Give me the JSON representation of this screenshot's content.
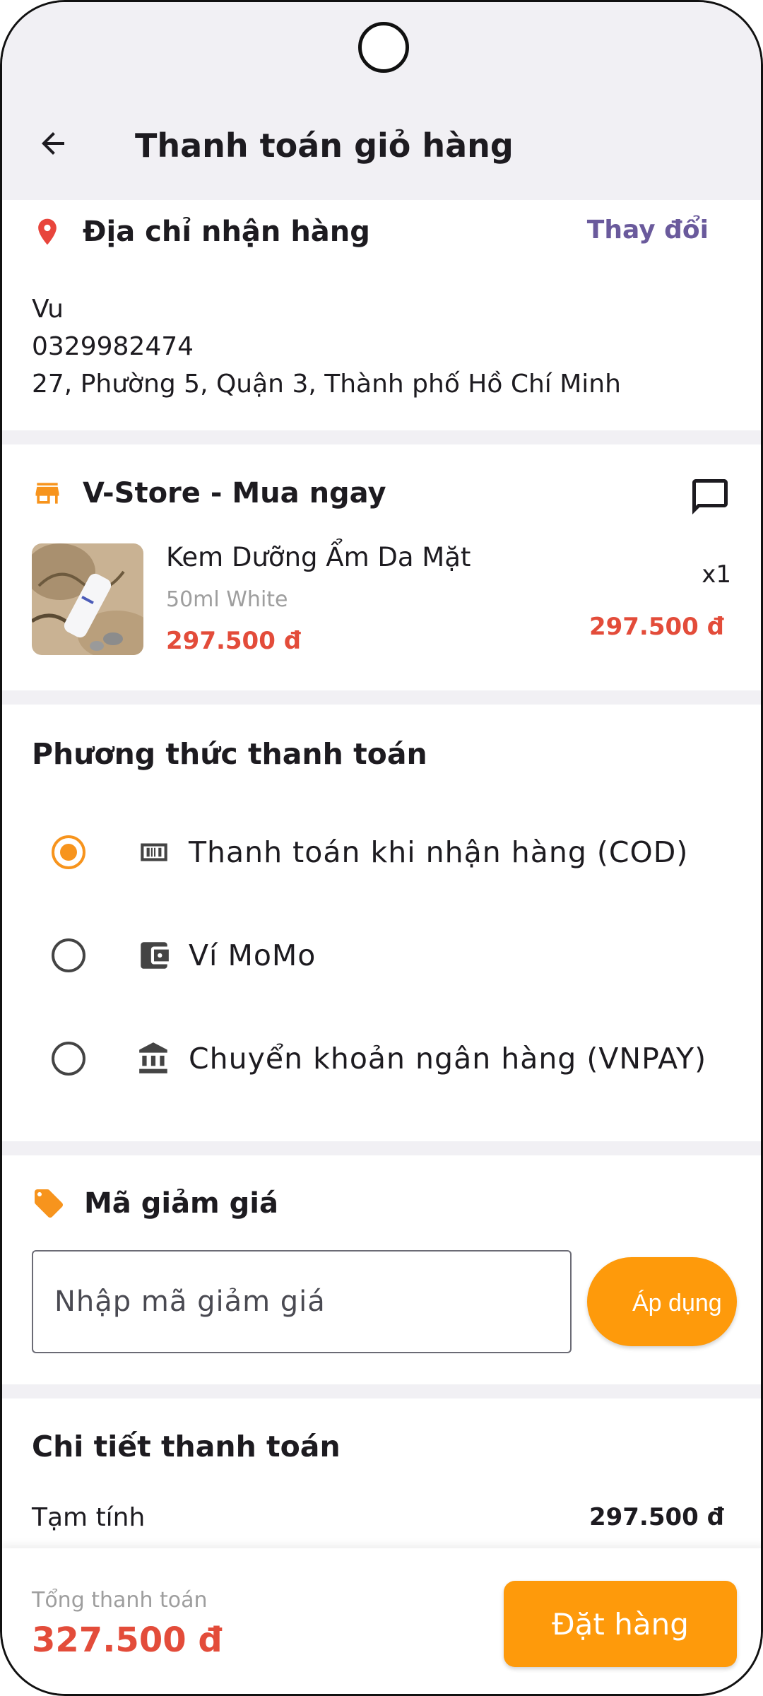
{
  "app_bar": {
    "title": "Thanh toán giỏ hàng"
  },
  "address": {
    "heading": "Địa chỉ nhận hàng",
    "change_label": "Thay đổi",
    "name": "Vu",
    "phone": "0329982474",
    "line": "27, Phường 5, Quận 3, Thành phố Hồ Chí Minh"
  },
  "store": {
    "name": "V-Store - Mua ngay",
    "product": {
      "name": "Kem Dưỡng Ẩm Da Mặt",
      "variant": "50ml White",
      "price": "297.500 đ",
      "quantity": "x1",
      "line_total": "297.500 đ"
    }
  },
  "payment": {
    "heading": "Phương thức thanh toán",
    "options": [
      {
        "label": "Thanh toán khi nhận hàng (COD)",
        "icon": "cash-icon",
        "selected": true
      },
      {
        "label": "Ví MoMo",
        "icon": "wallet-icon",
        "selected": false
      },
      {
        "label": "Chuyển khoản ngân hàng (VNPAY)",
        "icon": "bank-icon",
        "selected": false
      }
    ]
  },
  "coupon": {
    "heading": "Mã giảm giá",
    "placeholder": "Nhập mã giảm giá",
    "value": "",
    "apply_label": "Áp dụng"
  },
  "details": {
    "heading": "Chi tiết thanh toán",
    "subtotal_label": "Tạm tính",
    "subtotal_value": "297.500 đ"
  },
  "footer": {
    "total_label": "Tổng thanh toán",
    "total_value": "327.500 đ",
    "order_label": "Đặt hàng"
  },
  "colors": {
    "accent": "#fe9a0b",
    "price": "#e34c3a",
    "link": "#6a5a9c",
    "pin": "#e8453c"
  }
}
